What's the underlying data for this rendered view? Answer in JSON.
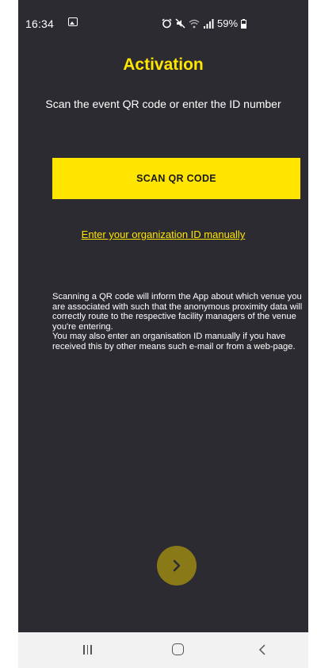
{
  "status_bar": {
    "time": "16:34",
    "battery": "59%",
    "icons": [
      "gallery-icon",
      "alarm-icon",
      "mute-icon",
      "wifi-icon",
      "signal-icon",
      "battery-icon"
    ]
  },
  "header": {
    "title": "Activation",
    "subtitle": "Scan the event QR code or enter the ID number"
  },
  "actions": {
    "scan_label": "SCAN QR CODE",
    "manual_link": "Enter your organization ID manually"
  },
  "info": {
    "paragraph1": "Scanning a QR code will inform the App about which venue you are associated with such that the anonymous proximity data will correctly route to the respective facility managers of the venue you're entering.",
    "paragraph2": "You may also enter an organisation ID manually if you have received this by other means such e-mail or from a web-page."
  },
  "next_button": {
    "icon": "chevron-right-icon"
  },
  "nav_bar": {
    "icons": [
      "recent-apps-icon",
      "home-icon",
      "back-icon"
    ]
  },
  "colors": {
    "background": "#2b2b31",
    "accent": "#ffe500",
    "next_button": "#8a7a17",
    "nav_bar": "#f2f2f2"
  }
}
